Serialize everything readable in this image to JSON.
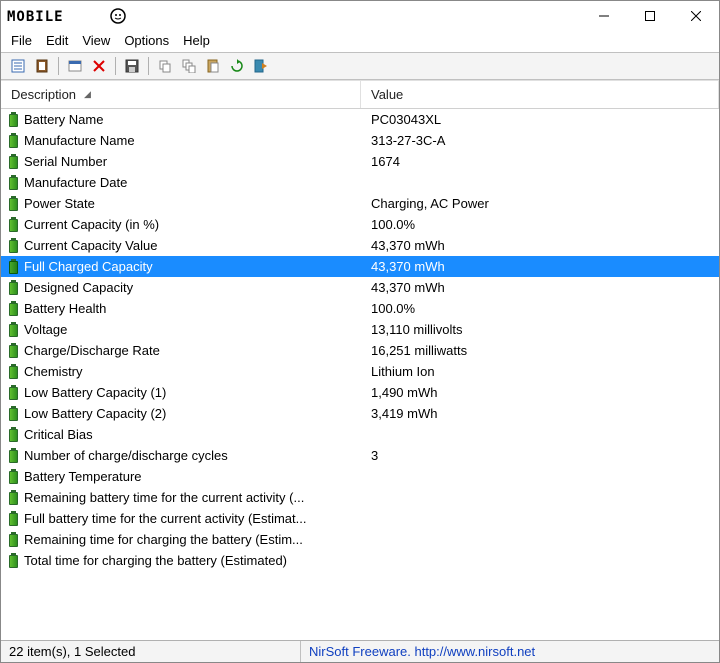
{
  "window": {
    "title_logo_text": "MOBILE"
  },
  "menu": {
    "file": "File",
    "edit": "Edit",
    "view": "View",
    "options": "Options",
    "help": "Help"
  },
  "columns": {
    "description": "Description",
    "value": "Value"
  },
  "rows": [
    {
      "desc": "Battery Name",
      "val": "PC03043XL",
      "selected": false
    },
    {
      "desc": "Manufacture Name",
      "val": "313-27-3C-A",
      "selected": false
    },
    {
      "desc": "Serial Number",
      "val": "1674",
      "selected": false
    },
    {
      "desc": "Manufacture Date",
      "val": "",
      "selected": false
    },
    {
      "desc": "Power State",
      "val": "Charging, AC Power",
      "selected": false
    },
    {
      "desc": "Current Capacity (in %)",
      "val": "100.0%",
      "selected": false
    },
    {
      "desc": "Current Capacity Value",
      "val": "43,370 mWh",
      "selected": false
    },
    {
      "desc": "Full Charged Capacity",
      "val": "43,370 mWh",
      "selected": true
    },
    {
      "desc": "Designed Capacity",
      "val": "43,370 mWh",
      "selected": false
    },
    {
      "desc": "Battery Health",
      "val": "100.0%",
      "selected": false
    },
    {
      "desc": "Voltage",
      "val": "13,110 millivolts",
      "selected": false
    },
    {
      "desc": "Charge/Discharge Rate",
      "val": "16,251 milliwatts",
      "selected": false
    },
    {
      "desc": "Chemistry",
      "val": "Lithium Ion",
      "selected": false
    },
    {
      "desc": "Low Battery Capacity (1)",
      "val": "1,490 mWh",
      "selected": false
    },
    {
      "desc": "Low Battery Capacity (2)",
      "val": "3,419 mWh",
      "selected": false
    },
    {
      "desc": "Critical Bias",
      "val": "",
      "selected": false
    },
    {
      "desc": "Number of charge/discharge cycles",
      "val": "3",
      "selected": false
    },
    {
      "desc": "Battery Temperature",
      "val": "",
      "selected": false
    },
    {
      "desc": "Remaining battery time for the current activity (...",
      "val": "",
      "selected": false
    },
    {
      "desc": "Full battery time for the current activity (Estimat...",
      "val": "",
      "selected": false
    },
    {
      "desc": "Remaining time for charging the battery (Estim...",
      "val": "",
      "selected": false
    },
    {
      "desc": "Total  time for charging the battery (Estimated)",
      "val": "",
      "selected": false
    }
  ],
  "status": {
    "left": "22 item(s), 1 Selected",
    "right": "NirSoft Freeware.  http://www.nirsoft.net"
  },
  "toolbar_icons": [
    "report-icon",
    "clipboard-icon",
    "properties-icon",
    "delete-icon",
    "save-icon",
    "copy-icon",
    "copy-all-icon",
    "paste-icon",
    "refresh-icon",
    "exit-icon"
  ]
}
